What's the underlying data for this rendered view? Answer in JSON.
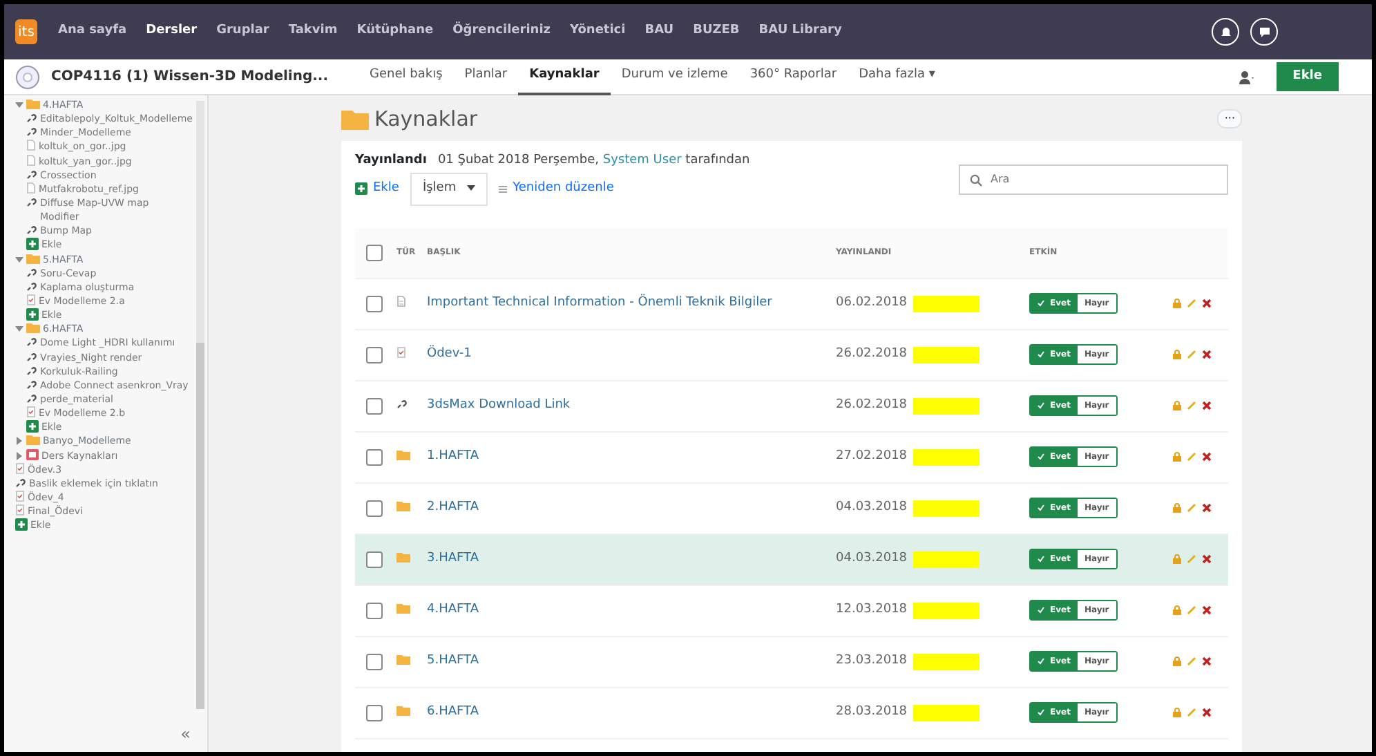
{
  "top_nav": {
    "logo": "its",
    "items": [
      {
        "label": "Ana sayfa",
        "selected": false
      },
      {
        "label": "Dersler",
        "selected": true
      },
      {
        "label": "Gruplar",
        "selected": false
      },
      {
        "label": "Takvim",
        "selected": false
      },
      {
        "label": "Kütüphane",
        "selected": false
      },
      {
        "label": "Öğrencileriniz",
        "selected": false
      },
      {
        "label": "Yönetici",
        "selected": false
      },
      {
        "label": "BAU",
        "selected": false
      },
      {
        "label": "BUZEB",
        "selected": false
      },
      {
        "label": "BAU Library",
        "selected": false
      }
    ]
  },
  "course_bar": {
    "title": "COP4116 (1) Wissen-3D Modeling...",
    "tabs": [
      {
        "label": "Genel bakış",
        "selected": false
      },
      {
        "label": "Planlar",
        "selected": false
      },
      {
        "label": "Kaynaklar",
        "selected": true
      },
      {
        "label": "Durum ve izleme",
        "selected": false
      },
      {
        "label": "360° Raporlar",
        "selected": false
      },
      {
        "label": "Daha fazla ▾",
        "selected": false
      }
    ],
    "add_button": "Ekle"
  },
  "sidebar": {
    "items": [
      {
        "kind": "folder",
        "label": "4.HAFTA",
        "expanded": true,
        "children": [
          {
            "kind": "link",
            "label": "Editablepoly_Koltuk_Modelleme"
          },
          {
            "kind": "link",
            "label": "Minder_Modelleme"
          },
          {
            "kind": "file",
            "label": "koltuk_on_gor..jpg"
          },
          {
            "kind": "file",
            "label": "koltuk_yan_gor..jpg"
          },
          {
            "kind": "link",
            "label": "Crossection"
          },
          {
            "kind": "file",
            "label": "Mutfakrobotu_ref.jpg"
          },
          {
            "kind": "link",
            "label": "Diffuse Map-UVW map Modifier"
          },
          {
            "kind": "link",
            "label": "Bump Map"
          },
          {
            "kind": "add",
            "label": "Ekle"
          }
        ]
      },
      {
        "kind": "folder",
        "label": "5.HAFTA",
        "expanded": true,
        "children": [
          {
            "kind": "link",
            "label": "Soru-Cevap"
          },
          {
            "kind": "link",
            "label": "Kaplama oluşturma"
          },
          {
            "kind": "assignment",
            "label": "Ev Modelleme 2.a"
          },
          {
            "kind": "add",
            "label": "Ekle"
          }
        ]
      },
      {
        "kind": "folder",
        "label": "6.HAFTA",
        "expanded": true,
        "children": [
          {
            "kind": "link",
            "label": "Dome Light _HDRI kullanımı"
          },
          {
            "kind": "link",
            "label": "Vrayies_Night render"
          },
          {
            "kind": "link",
            "label": "Korkuluk-Railing"
          },
          {
            "kind": "link",
            "label": "Adobe Connect asenkron_Vray"
          },
          {
            "kind": "link",
            "label": "perde_material"
          },
          {
            "kind": "assignment",
            "label": "Ev Modelleme 2.b"
          },
          {
            "kind": "add",
            "label": "Ekle"
          }
        ]
      },
      {
        "kind": "folder",
        "label": "Banyo_Modelleme",
        "expanded": false
      },
      {
        "kind": "module",
        "label": "Ders Kaynakları",
        "expanded": false
      },
      {
        "kind": "assignment",
        "label": "Ödev.3"
      },
      {
        "kind": "link",
        "label": "Baslik eklemek için tıklatın"
      },
      {
        "kind": "assignment",
        "label": "Ödev_4"
      },
      {
        "kind": "assignment",
        "label": "Final_Ödevi"
      },
      {
        "kind": "add",
        "label": "Ekle"
      }
    ],
    "collapse": "«"
  },
  "page": {
    "title": "Kaynaklar",
    "more_button": "···",
    "published_label": "Yayınlandı",
    "published_text": "01 Şubat 2018 Perşembe,",
    "published_by": "System User",
    "published_suffix": "tarafından",
    "add": "Ekle",
    "action_select": "İşlem",
    "reorder": "Yeniden düzenle",
    "search": {
      "placeholder": "Ara"
    }
  },
  "table": {
    "all_checked": false,
    "columns": [
      "TÜR",
      "BAŞLIK",
      "YAYINLANDI",
      "ETKİN"
    ],
    "rows": [
      {
        "kind": "document",
        "title": "Important Technical Information - Önemli Teknik Bilgiler",
        "date": "06.02.2018",
        "checked": false,
        "selected": false,
        "enabled": true,
        "yes": "Evet",
        "no": "Hayır"
      },
      {
        "kind": "assignment",
        "title": "Ödev-1",
        "date": "26.02.2018",
        "checked": false,
        "selected": false,
        "enabled": true,
        "yes": "Evet",
        "no": "Hayır"
      },
      {
        "kind": "link",
        "title": "3dsMax Download Link",
        "date": "26.02.2018",
        "checked": false,
        "selected": false,
        "enabled": true,
        "yes": "Evet",
        "no": "Hayır"
      },
      {
        "kind": "folder",
        "title": "1.HAFTA",
        "date": "27.02.2018",
        "checked": false,
        "selected": false,
        "enabled": true,
        "yes": "Evet",
        "no": "Hayır"
      },
      {
        "kind": "folder",
        "title": "2.HAFTA",
        "date": "04.03.2018",
        "checked": false,
        "selected": false,
        "enabled": true,
        "yes": "Evet",
        "no": "Hayır"
      },
      {
        "kind": "folder",
        "title": "3.HAFTA",
        "date": "04.03.2018",
        "checked": false,
        "selected": true,
        "enabled": true,
        "yes": "Evet",
        "no": "Hayır"
      },
      {
        "kind": "folder",
        "title": "4.HAFTA",
        "date": "12.03.2018",
        "checked": false,
        "selected": false,
        "enabled": true,
        "yes": "Evet",
        "no": "Hayır"
      },
      {
        "kind": "folder",
        "title": "5.HAFTA",
        "date": "23.03.2018",
        "checked": false,
        "selected": false,
        "enabled": true,
        "yes": "Evet",
        "no": "Hayır"
      },
      {
        "kind": "folder",
        "title": "6.HAFTA",
        "date": "28.03.2018",
        "checked": false,
        "selected": false,
        "enabled": true,
        "yes": "Evet",
        "no": "Hayır"
      }
    ]
  }
}
